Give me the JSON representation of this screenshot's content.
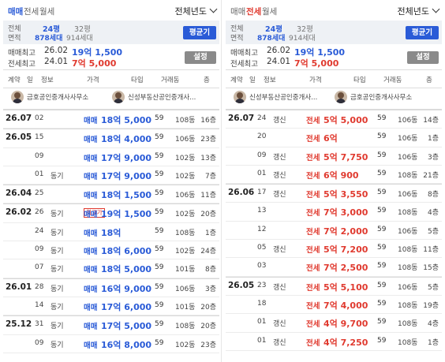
{
  "left": {
    "tabs": [
      "매매",
      "전세",
      "월세"
    ],
    "active_tab": 0,
    "year_select": "전체년도",
    "area_label": [
      "전체",
      "면적"
    ],
    "sizes": [
      {
        "size": "24평",
        "households": "878세대",
        "selected": true
      },
      {
        "size": "32평",
        "households": "914세대",
        "selected": false
      }
    ],
    "avg_button": "평균기",
    "price_rows": [
      {
        "label": "매매최고",
        "date": "26.02",
        "value": "19억 1,500",
        "color": "blue"
      },
      {
        "label": "전세최고",
        "date": "24.01",
        "value": "7억 5,000",
        "color": "red"
      }
    ],
    "settings_button": "설정",
    "columns": {
      "contract": "계약",
      "day": "일",
      "info": "정보",
      "price": "가격",
      "type": "타입",
      "floor_info": "거래동",
      "floor": "층"
    },
    "agents": [
      "금호공인중개사사무소",
      "신성부동산공인중개사..."
    ],
    "rows": [
      {
        "ym": "26.07",
        "d": "02",
        "k": "",
        "pt": "매매",
        "pv": "18억 5,000",
        "color": "blue",
        "t": "59",
        "b": "108동",
        "f": "16층"
      },
      {
        "ym": "26.05",
        "d": "15",
        "k": "",
        "pt": "매매",
        "pv": "18억 4,000",
        "color": "blue",
        "t": "59",
        "b": "106동",
        "f": "23층"
      },
      {
        "ym": "",
        "d": "09",
        "k": "",
        "pt": "매매",
        "pv": "17억 9,000",
        "color": "blue",
        "t": "59",
        "b": "102동",
        "f": "13층"
      },
      {
        "ym": "",
        "d": "01",
        "k": "동기",
        "pt": "매매",
        "pv": "17억 9,000",
        "color": "blue",
        "t": "59",
        "b": "102동",
        "f": "7층"
      },
      {
        "ym": "26.04",
        "d": "25",
        "k": "",
        "pt": "매매",
        "pv": "18억 1,500",
        "color": "blue",
        "t": "59",
        "b": "106동",
        "f": "11층"
      },
      {
        "ym": "26.02",
        "d": "26",
        "k": "동기",
        "pt": "매매",
        "pv": "19억 1,500",
        "color": "blue",
        "t": "59",
        "b": "102동",
        "f": "20층",
        "badge": "최고가"
      },
      {
        "ym": "",
        "d": "24",
        "k": "동기",
        "pt": "매매",
        "pv": "18억",
        "color": "blue",
        "t": "59",
        "b": "108동",
        "f": "1층"
      },
      {
        "ym": "",
        "d": "09",
        "k": "동기",
        "pt": "매매",
        "pv": "18억 6,000",
        "color": "blue",
        "t": "59",
        "b": "102동",
        "f": "24층"
      },
      {
        "ym": "",
        "d": "07",
        "k": "동기",
        "pt": "매매",
        "pv": "18억 5,000",
        "color": "blue",
        "t": "59",
        "b": "101동",
        "f": "8층"
      },
      {
        "ym": "26.01",
        "d": "28",
        "k": "동기",
        "pt": "매매",
        "pv": "16억 9,000",
        "color": "blue",
        "t": "59",
        "b": "106동",
        "f": "3층"
      },
      {
        "ym": "",
        "d": "14",
        "k": "동기",
        "pt": "매매",
        "pv": "17억 6,000",
        "color": "blue",
        "t": "59",
        "b": "101동",
        "f": "20층"
      },
      {
        "ym": "25.12",
        "d": "31",
        "k": "동기",
        "pt": "매매",
        "pv": "17억 5,000",
        "color": "blue",
        "t": "59",
        "b": "108동",
        "f": "20층"
      },
      {
        "ym": "",
        "d": "09",
        "k": "동기",
        "pt": "매매",
        "pv": "16억 8,000",
        "color": "blue",
        "t": "59",
        "b": "102동",
        "f": "23층"
      }
    ]
  },
  "right": {
    "tabs": [
      "매매",
      "전세",
      "월세"
    ],
    "active_tab": 1,
    "year_select": "전체년도",
    "area_label": [
      "전체",
      "면적"
    ],
    "sizes": [
      {
        "size": "24평",
        "households": "878세대",
        "selected": true
      },
      {
        "size": "32평",
        "households": "914세대",
        "selected": false
      }
    ],
    "avg_button": "평균기",
    "price_rows": [
      {
        "label": "매매최고",
        "date": "26.02",
        "value": "19억 1,500",
        "color": "blue"
      },
      {
        "label": "전세최고",
        "date": "24.01",
        "value": "7억 5,000",
        "color": "red"
      }
    ],
    "settings_button": "설정",
    "columns": {
      "contract": "계약",
      "day": "일",
      "info": "정보",
      "price": "가격",
      "type": "타입",
      "floor_info": "거래동",
      "floor": "층"
    },
    "agents": [
      "신성부동산공인중개사...",
      "금호공인중개사사무소"
    ],
    "rows": [
      {
        "ym": "26.07",
        "d": "24",
        "k": "갱신",
        "pt": "전세",
        "pv": "5억 5,000",
        "color": "red",
        "t": "59",
        "b": "106동",
        "f": "14층"
      },
      {
        "ym": "",
        "d": "20",
        "k": "",
        "pt": "전세",
        "pv": "6억",
        "color": "red",
        "t": "59",
        "b": "106동",
        "f": "1층"
      },
      {
        "ym": "",
        "d": "09",
        "k": "갱신",
        "pt": "전세",
        "pv": "5억 7,750",
        "color": "red",
        "t": "59",
        "b": "106동",
        "f": "3층"
      },
      {
        "ym": "",
        "d": "01",
        "k": "갱신",
        "pt": "전세",
        "pv": "6억 900",
        "color": "red",
        "t": "59",
        "b": "108동",
        "f": "21층"
      },
      {
        "ym": "26.06",
        "d": "17",
        "k": "갱신",
        "pt": "전세",
        "pv": "5억 3,550",
        "color": "red",
        "t": "59",
        "b": "106동",
        "f": "8층"
      },
      {
        "ym": "",
        "d": "13",
        "k": "",
        "pt": "전세",
        "pv": "7억 3,000",
        "color": "red",
        "t": "59",
        "b": "108동",
        "f": "4층"
      },
      {
        "ym": "",
        "d": "12",
        "k": "",
        "pt": "전세",
        "pv": "7억 2,000",
        "color": "red",
        "t": "59",
        "b": "106동",
        "f": "5층"
      },
      {
        "ym": "",
        "d": "05",
        "k": "갱신",
        "pt": "전세",
        "pv": "5억 7,200",
        "color": "red",
        "t": "59",
        "b": "108동",
        "f": "11층"
      },
      {
        "ym": "",
        "d": "03",
        "k": "",
        "pt": "전세",
        "pv": "7억 2,500",
        "color": "red",
        "t": "59",
        "b": "108동",
        "f": "15층"
      },
      {
        "ym": "26.05",
        "d": "23",
        "k": "갱신",
        "pt": "전세",
        "pv": "5억 5,100",
        "color": "red",
        "t": "59",
        "b": "106동",
        "f": "5층"
      },
      {
        "ym": "",
        "d": "18",
        "k": "",
        "pt": "전세",
        "pv": "7억 4,000",
        "color": "red",
        "t": "59",
        "b": "108동",
        "f": "19층"
      },
      {
        "ym": "",
        "d": "01",
        "k": "갱신",
        "pt": "전세",
        "pv": "4억 9,700",
        "color": "red",
        "t": "59",
        "b": "108동",
        "f": "4층"
      },
      {
        "ym": "",
        "d": "01",
        "k": "갱신",
        "pt": "전세",
        "pv": "4억 7,250",
        "color": "red",
        "t": "59",
        "b": "108동",
        "f": "1층"
      }
    ]
  }
}
